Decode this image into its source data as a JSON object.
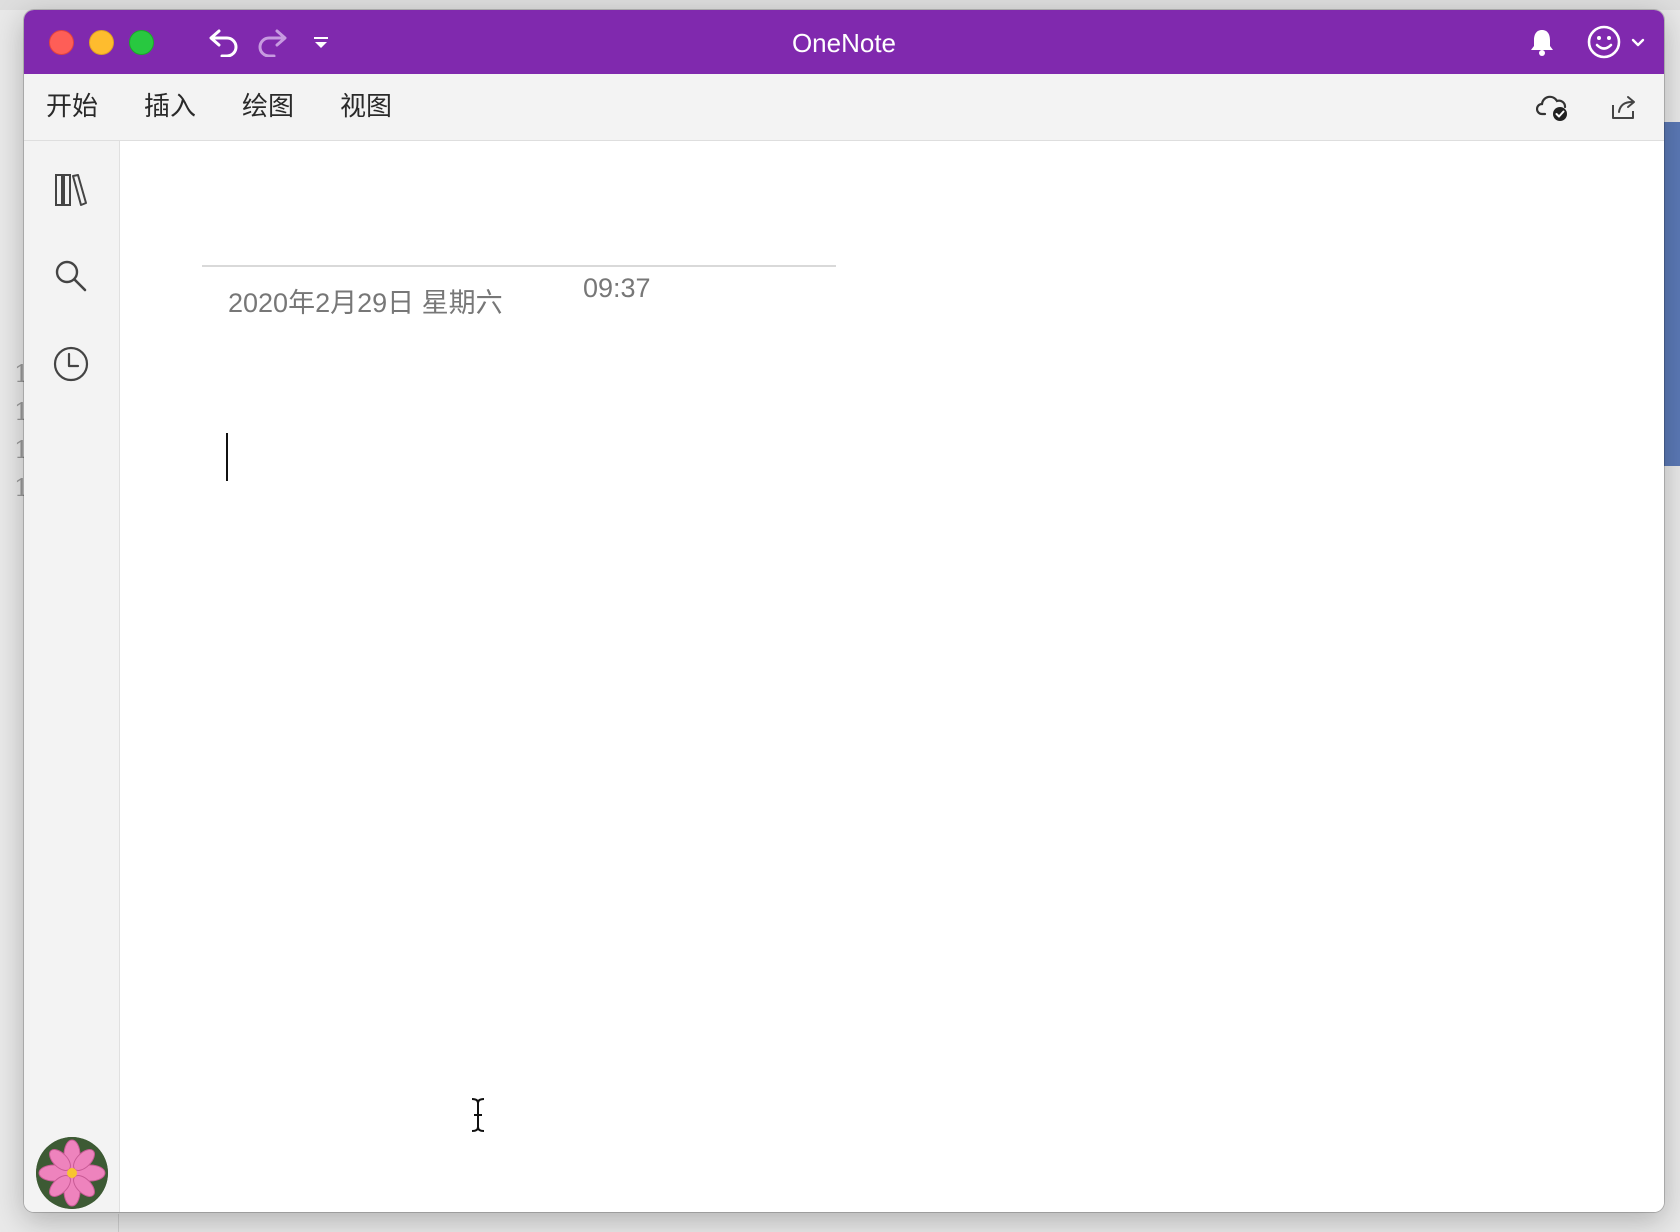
{
  "window": {
    "title": "OneNote",
    "accent_color": "#8029ae"
  },
  "titlebar": {
    "buttons": [
      {
        "name": "close",
        "color": "#fe5e57"
      },
      {
        "name": "minimize",
        "color": "#febc2e"
      },
      {
        "name": "zoom",
        "color": "#28c840"
      }
    ],
    "icons": [
      "undo-icon",
      "redo-icon",
      "customize-toolbar-icon",
      "bell-icon",
      "smiley-feedback-icon",
      "chevron-down-icon"
    ]
  },
  "ribbon": {
    "tabs": [
      {
        "label": "开始"
      },
      {
        "label": "插入"
      },
      {
        "label": "绘图"
      },
      {
        "label": "视图"
      }
    ],
    "right_icons": [
      "cloud-sync-check-icon",
      "share-icon"
    ]
  },
  "rail": {
    "icons": [
      "notebooks-icon",
      "search-icon",
      "recent-clock-icon"
    ],
    "avatar": "flower-avatar"
  },
  "page": {
    "date": "2020年2月29日 星期六",
    "time": "09:37"
  },
  "background": {
    "left_digits": [
      "1",
      "1",
      "1",
      "1"
    ],
    "panel_color": "#5b79b6"
  }
}
